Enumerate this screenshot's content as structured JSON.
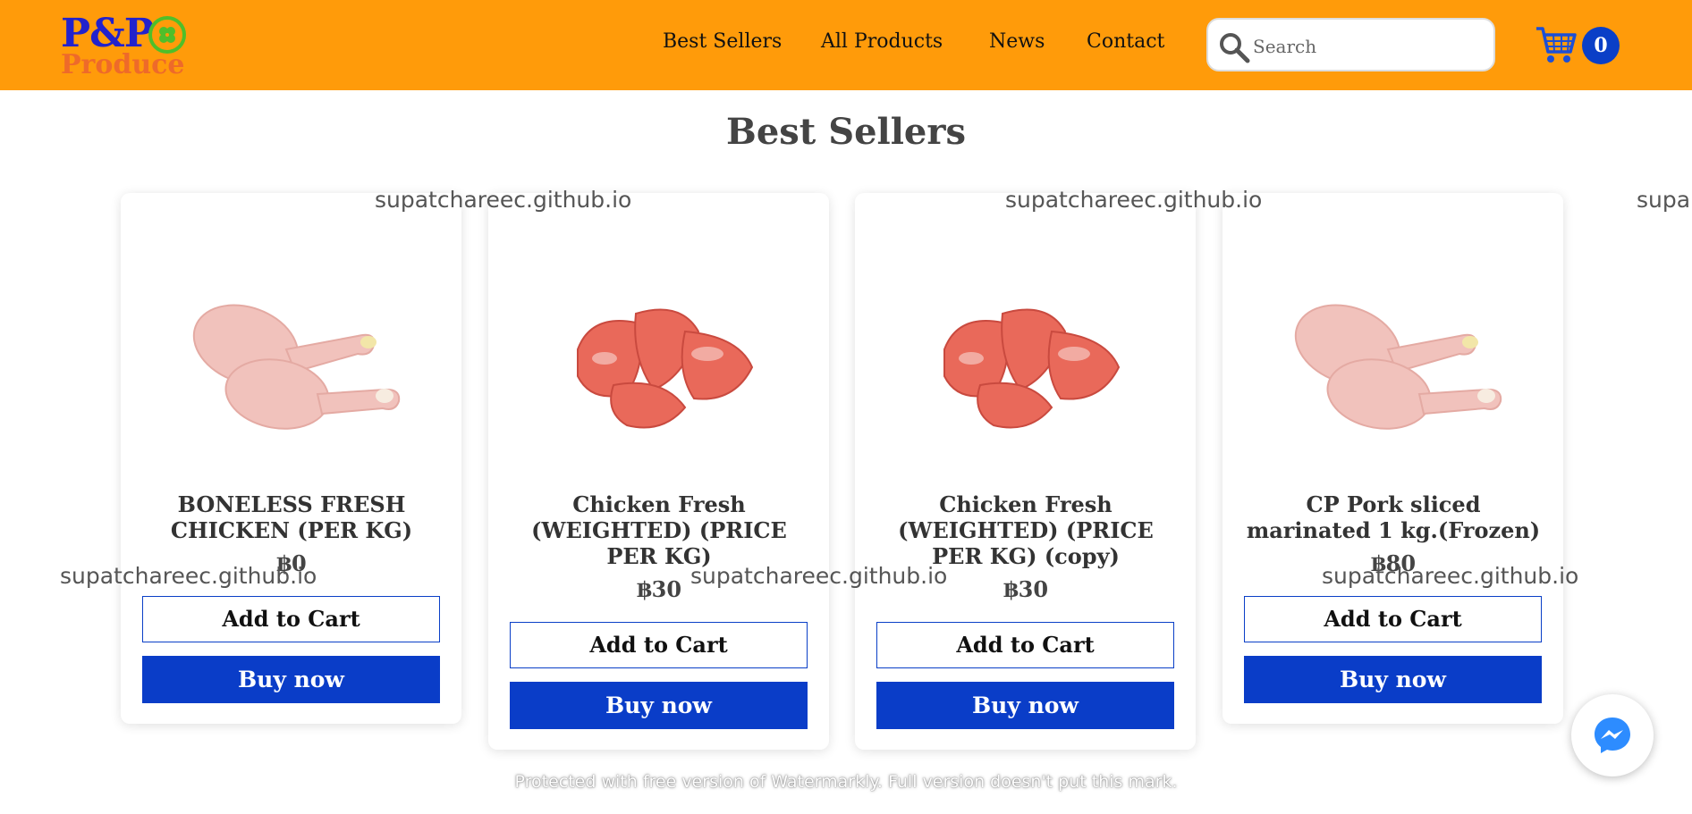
{
  "header": {
    "logo": {
      "line1": "P&P",
      "line2": "Produce"
    },
    "nav": [
      "Best Sellers",
      "All Products",
      "News",
      "Contact"
    ],
    "search": {
      "placeholder": "Search",
      "value": ""
    },
    "cart_count": "0"
  },
  "main": {
    "title": "Best Sellers",
    "products": [
      {
        "name": "BONELESS FRESH CHICKEN (PER KG)",
        "price": "฿0",
        "image": "chicken-drumsticks",
        "add_label": "Add to Cart",
        "buy_label": "Buy now"
      },
      {
        "name": "Chicken Fresh (WEIGHTED) (PRICE PER KG)",
        "price": "฿30",
        "image": "raw-meat-chunks",
        "add_label": "Add to Cart",
        "buy_label": "Buy now"
      },
      {
        "name": "Chicken Fresh (WEIGHTED) (PRICE PER KG) (copy)",
        "price": "฿30",
        "image": "raw-meat-chunks",
        "add_label": "Add to Cart",
        "buy_label": "Buy now"
      },
      {
        "name": "CP Pork sliced marinated 1 kg.(Frozen)",
        "price": "฿80",
        "image": "chicken-drumsticks",
        "add_label": "Add to Cart",
        "buy_label": "Buy now"
      }
    ]
  },
  "watermarks": {
    "text": "supatchareec.github.io",
    "text_cut": "supa",
    "footer": "Protected with free version of Watermarkly. Full version doesn't put this mark."
  },
  "colors": {
    "header": "#ff9b0a",
    "accent": "#0a3fc7"
  },
  "icons": [
    "search-icon",
    "cart-icon",
    "messenger-icon",
    "clover-icon"
  ]
}
